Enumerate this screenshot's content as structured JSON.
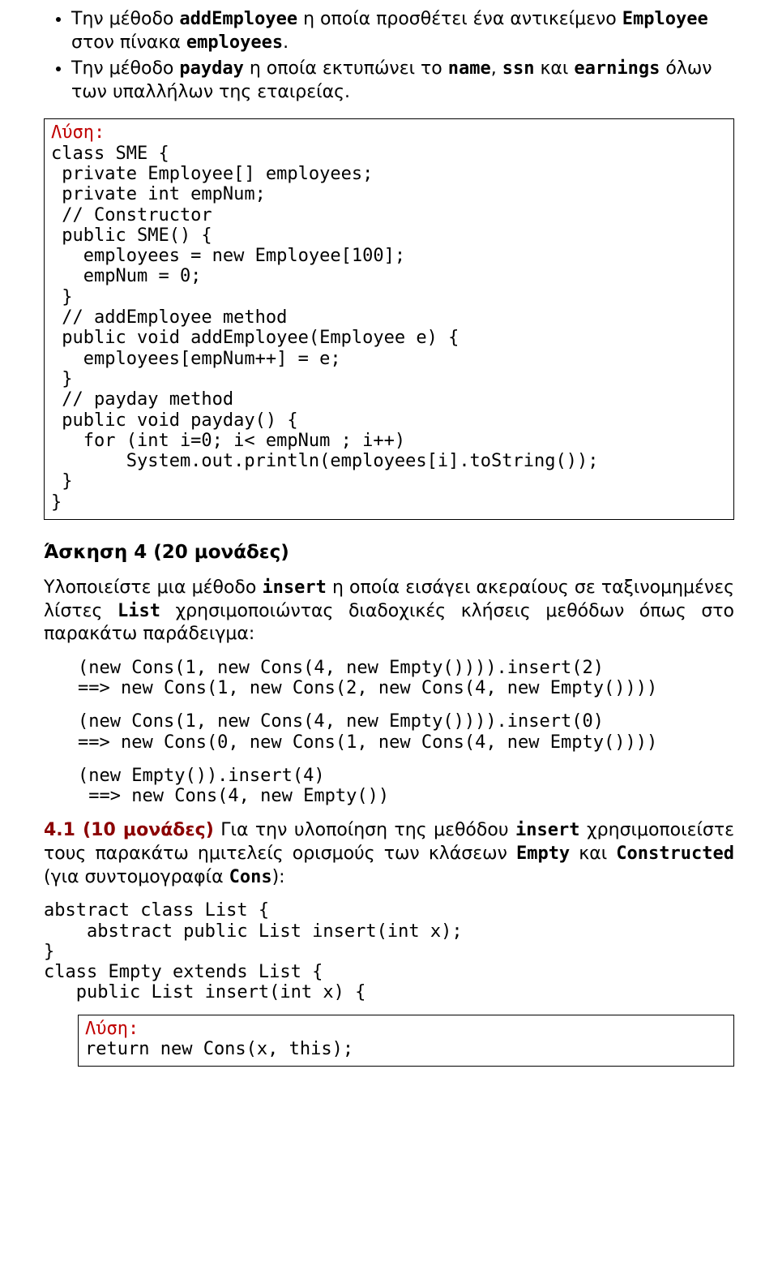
{
  "bullets": {
    "item1_pre": "Την μέθοδο ",
    "item1_m1": "addEmployee",
    "item1_mid1": " η οποία προσθέτει ένα αντικείμενο ",
    "item1_m2": "Employee",
    "item1_mid2": " στον πίνακα ",
    "item1_m3": "employees",
    "item1_end": ".",
    "item2_pre": "Την μέθοδο ",
    "item2_m1": "payday",
    "item2_mid1": " η οποία εκτυπώνει το ",
    "item2_m2": "name",
    "item2_sep1": ", ",
    "item2_m3": "ssn",
    "item2_sep2": " και ",
    "item2_m4": "earnings",
    "item2_end": " όλων των υπαλλήλων της εταιρείας."
  },
  "box1": {
    "label": "Λύση:",
    "code": "class SME {\n private Employee[] employees;\n private int empNum;\n // Constructor\n public SME() {\n   employees = new Employee[100];\n   empNum = 0;\n }\n // addEmployee method\n public void addEmployee(Employee e) {\n   employees[empNum++] = e;\n }\n // payday method\n public void payday() {\n   for (int i=0; i< empNum ; i++)\n       System.out.println(employees[i].toString());\n }\n}"
  },
  "ex4": {
    "heading": "Άσκηση 4 (20 μονάδες)",
    "p1_a": "Υλοποιείστε μια μέθοδο ",
    "p1_m1": "insert",
    "p1_b": " η οποία εισάγει ακεραίους σε ταξινομημένες λίστες ",
    "p1_m2": "List",
    "p1_c": " χρησιμοποιώντας διαδοχικές κλήσεις μεθόδων όπως στο παρακάτω παράδειγμα:",
    "ex1": "(new Cons(1, new Cons(4, new Empty()))).insert(2)\n==> new Cons(1, new Cons(2, new Cons(4, new Empty())))",
    "ex2": "(new Cons(1, new Cons(4, new Empty()))).insert(0)\n==> new Cons(0, new Cons(1, new Cons(4, new Empty())))",
    "ex3": "(new Empty()).insert(4)\n ==> new Cons(4, new Empty())",
    "p2_lead": "4.1 (10 μονάδες)",
    "p2_a": " Για την υλοποίηση της μεθόδου ",
    "p2_m1": "insert",
    "p2_b": " χρησιμοποιείστε τους παρακάτω ημιτελείς ορισμούς των κλάσεων ",
    "p2_m2": "Empty",
    "p2_c": " και ",
    "p2_m3": "Constructed",
    "p2_d": " (για συντομογραφία ",
    "p2_m4": "Cons",
    "p2_e": "):",
    "code2": "abstract class List {\n    abstract public List insert(int x);\n}\nclass Empty extends List {\n   public List insert(int x) {"
  },
  "box2": {
    "label": "Λύση:",
    "code": "return new Cons(x, this);"
  }
}
